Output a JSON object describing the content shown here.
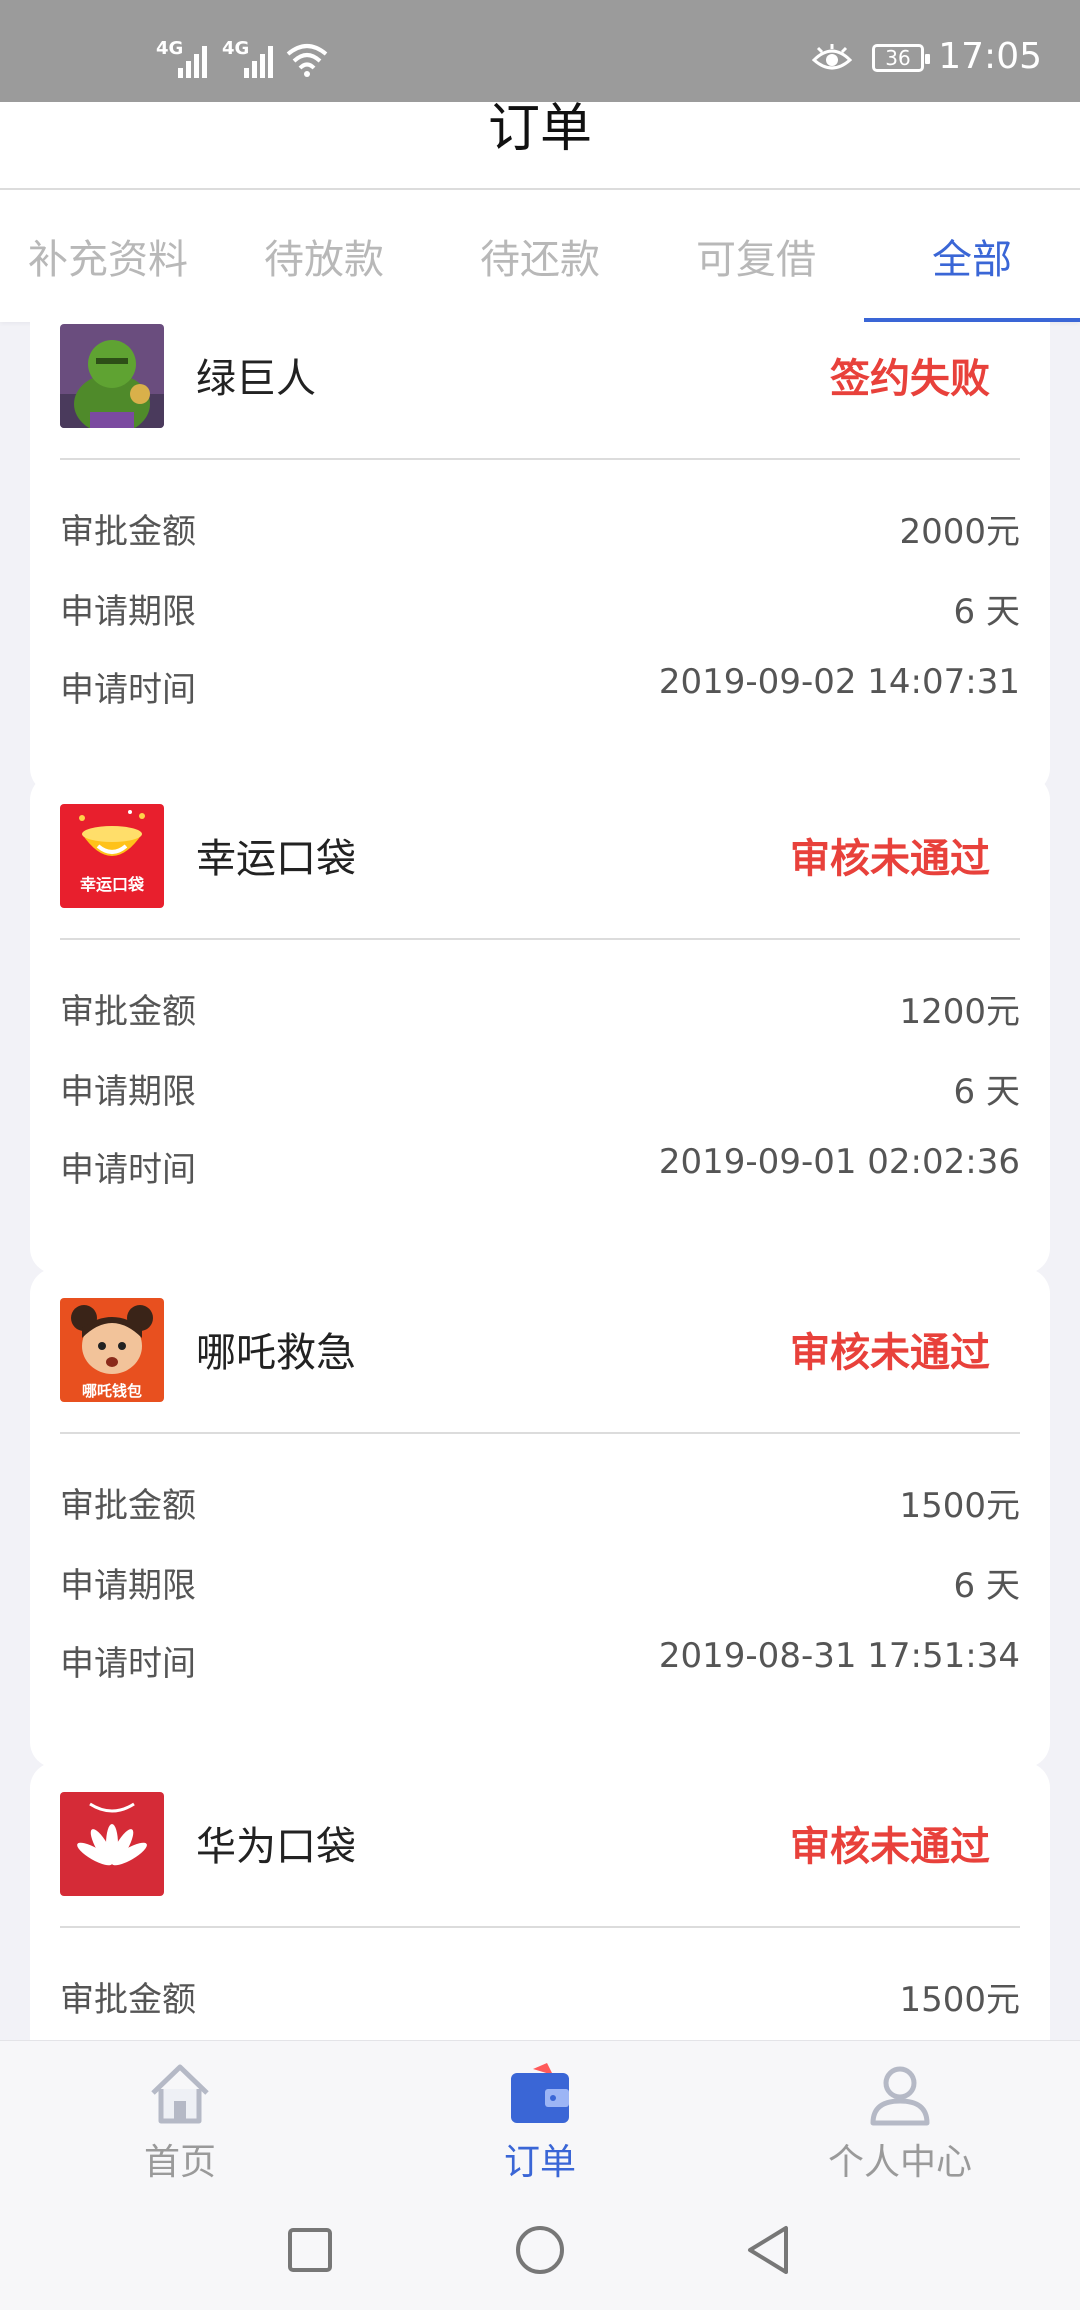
{
  "status_bar": {
    "signal1": "4G",
    "signal2": "4G",
    "battery": "36",
    "time": "17:05"
  },
  "header": {
    "title": "订单"
  },
  "tabs": [
    {
      "label": "补充资料"
    },
    {
      "label": "待放款"
    },
    {
      "label": "待还款"
    },
    {
      "label": "可复借"
    },
    {
      "label": "全部"
    }
  ],
  "active_tab": "全部",
  "orders": [
    {
      "name": "绿巨人",
      "status": "签约失败",
      "amount_label": "审批金额",
      "amount": "2000元",
      "term_label": "申请期限",
      "term": "6 天",
      "time_label": "申请时间",
      "time": "2019-09-02 14:07:31",
      "logo": "hulk-logo"
    },
    {
      "name": "幸运口袋",
      "status": "审核未通过",
      "amount_label": "审批金额",
      "amount": "1200元",
      "term_label": "申请期限",
      "term": "6 天",
      "time_label": "申请时间",
      "time": "2019-09-01 02:02:36",
      "logo": "lucky-pocket-logo",
      "logo_text": "幸运口袋"
    },
    {
      "name": "哪吒救急",
      "status": "审核未通过",
      "amount_label": "审批金额",
      "amount": "1500元",
      "term_label": "申请期限",
      "term": "6 天",
      "time_label": "申请时间",
      "time": "2019-08-31 17:51:34",
      "logo": "nezha-logo",
      "logo_text": "哪吒钱包"
    },
    {
      "name": "华为口袋",
      "status": "审核未通过",
      "amount_label": "审批金额",
      "amount": "1500元",
      "logo": "huawei-pocket-logo"
    }
  ],
  "bottom_nav": [
    {
      "label": "首页",
      "icon": "home-icon"
    },
    {
      "label": "订单",
      "icon": "wallet-icon"
    },
    {
      "label": "个人中心",
      "icon": "person-icon"
    }
  ],
  "colors": {
    "accent": "#3a66d6",
    "status_red": "#e8413b",
    "status_bar": "#9b9b9b",
    "page_background": "#f2f2f7"
  }
}
